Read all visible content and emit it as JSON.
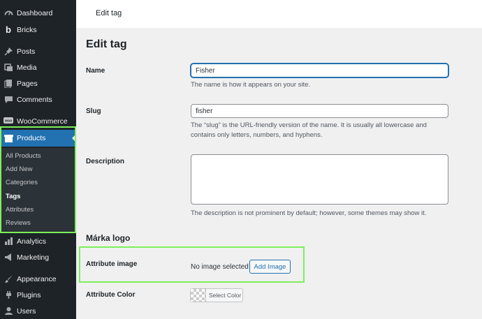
{
  "sidebar": {
    "items": [
      {
        "label": "Dashboard",
        "icon": "dashboard-icon"
      },
      {
        "label": "Bricks",
        "icon": "bricks-icon"
      },
      {
        "label": "Posts",
        "icon": "pin-icon"
      },
      {
        "label": "Media",
        "icon": "media-icon"
      },
      {
        "label": "Pages",
        "icon": "pages-icon"
      },
      {
        "label": "Comments",
        "icon": "comment-icon"
      },
      {
        "label": "WooCommerce",
        "icon": "woo-icon"
      },
      {
        "label": "Products",
        "icon": "products-icon"
      },
      {
        "label": "Analytics",
        "icon": "analytics-icon"
      },
      {
        "label": "Marketing",
        "icon": "megaphone-icon"
      },
      {
        "label": "Appearance",
        "icon": "brush-icon"
      },
      {
        "label": "Plugins",
        "icon": "plug-icon"
      },
      {
        "label": "Users",
        "icon": "user-icon"
      }
    ],
    "submenu": [
      "All Products",
      "Add New",
      "Categories",
      "Tags",
      "Attributes",
      "Reviews"
    ]
  },
  "topbar": {
    "title": "Edit tag"
  },
  "main": {
    "title": "Edit tag",
    "name": {
      "label": "Name",
      "value": "Fisher",
      "help": "The name is how it appears on your site."
    },
    "slug": {
      "label": "Slug",
      "value": "fisher",
      "help": "The “slug” is the URL-friendly version of the name. It is usually all lowercase and contains only letters, numbers, and hyphens."
    },
    "description": {
      "label": "Description",
      "value": "",
      "help": "The description is not prominent by default; however, some themes may show it."
    },
    "section_title": "Márka logo",
    "attribute_image": {
      "label": "Attribute image",
      "status": "No image selected",
      "button": "Add Image"
    },
    "attribute_color": {
      "label": "Attribute Color",
      "button": "Select Color"
    }
  },
  "colors": {
    "sidebar_bg": "#1d2327",
    "accent": "#2271b1",
    "highlight": "#7cf05a"
  }
}
